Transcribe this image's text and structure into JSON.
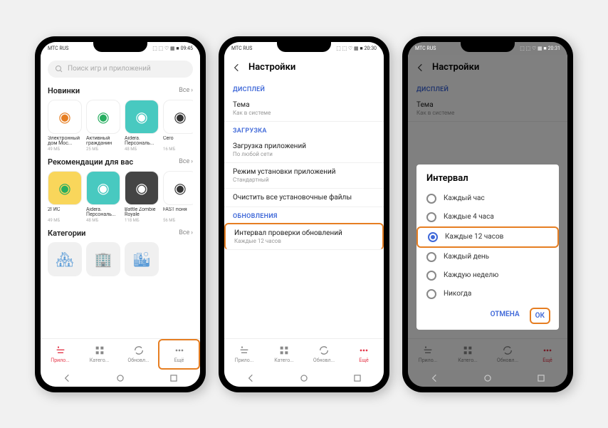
{
  "statusbar": {
    "carrier": "МТС RUS",
    "time1": "09:45",
    "time2": "20:30",
    "time3": "20:31",
    "icons": "⬚ ⬚ ♡ ▦ ■"
  },
  "screen1": {
    "search_placeholder": "Поиск игр и приложений",
    "sec_new": "Новинки",
    "sec_rec": "Рекомендации для вас",
    "sec_cat": "Категории",
    "all": "Все",
    "apps_new": [
      {
        "name": "Электронный дом Мос...",
        "size": "49 МБ",
        "bg": "#fff",
        "fg": "#e67e22"
      },
      {
        "name": "Активный гражданин",
        "size": "25 МБ",
        "bg": "#fff",
        "fg": "#27ae60"
      },
      {
        "name": "Aidera. Персональ...",
        "size": "48 МБ",
        "bg": "#48c9c0",
        "fg": "#fff"
      },
      {
        "name": "Cero",
        "size": "16 МБ",
        "bg": "#fff",
        "fg": "#333"
      }
    ],
    "apps_rec": [
      {
        "name": "2ГИС",
        "size": "49 МБ",
        "bg": "#f9d65b",
        "fg": "#27ae60"
      },
      {
        "name": "Aidera. Персональ...",
        "size": "48 МБ",
        "bg": "#48c9c0",
        "fg": "#fff"
      },
      {
        "name": "Battle Zombie Royale",
        "size": "118 МБ",
        "bg": "#444",
        "fg": "#fff"
      },
      {
        "name": "FAST поня",
        "size": "56 МБ",
        "bg": "#fff",
        "fg": "#333"
      }
    ]
  },
  "tabs": {
    "t1": "Прило...",
    "t2": "Катего...",
    "t3": "Обновл...",
    "t4": "Ещё"
  },
  "screen2": {
    "title": "Настройки",
    "sec_display": "ДИСПЛЕЙ",
    "sec_download": "ЗАГРУЗКА",
    "sec_updates": "ОБНОВЛЕНИЯ",
    "theme": "Тема",
    "theme_sub": "Как в системе",
    "download": "Загрузка приложений",
    "download_sub": "По любой сети",
    "install": "Режим установки приложений",
    "install_sub": "Стандартный",
    "clear": "Очистить все установочные файлы",
    "interval": "Интервал проверки обновлений",
    "interval_sub": "Каждые 12 часов"
  },
  "dialog": {
    "title": "Интервал",
    "opt1": "Каждый час",
    "opt2": "Каждые 4 часа",
    "opt3": "Каждые 12 часов",
    "opt4": "Каждый день",
    "opt5": "Каждую неделю",
    "opt6": "Никогда",
    "cancel": "ОТМЕНА",
    "ok": "ОК"
  }
}
